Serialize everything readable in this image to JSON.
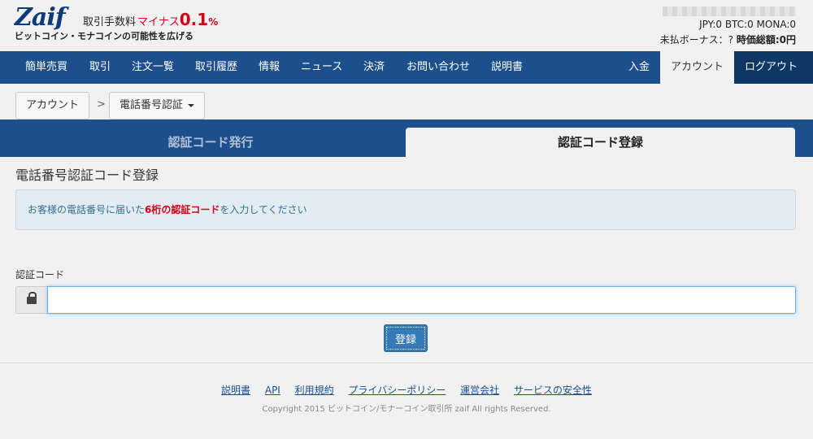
{
  "header": {
    "logo": "Zaif",
    "fee_label": "取引手数料",
    "fee_minus": "マイナス",
    "fee_value": "0.1",
    "fee_unit": "%",
    "tagline": "ビットコイン・モナコインの可能性を広げる",
    "balances": "JPY:0 BTC:0 MONA:0",
    "bonus_label": "未払ボーナス：?",
    "total_label": "時価総額:0円"
  },
  "nav": {
    "items": [
      "簡単売買",
      "取引",
      "注文一覧",
      "取引履歴",
      "情報",
      "ニュース",
      "決済",
      "お問い合わせ",
      "説明書"
    ],
    "deposit": "入金",
    "account": "アカウント",
    "logout": "ログアウト"
  },
  "breadcrumb": {
    "root": "アカウント",
    "separator": ">",
    "current": "電話番号認証"
  },
  "tabs": {
    "issue": "認証コード発行",
    "register": "認証コード登録"
  },
  "main": {
    "title": "電話番号認証コード登録",
    "alert_prefix": "お客様の電話番号に届いた",
    "alert_emphasis": "6桁の認証コード",
    "alert_suffix": "を入力してください",
    "field_label": "認証コード",
    "input_value": "",
    "submit_label": "登録"
  },
  "footer": {
    "links": [
      "説明書",
      "API",
      "利用規約",
      "プライバシーポリシー",
      "運営会社",
      "サービスの安全性"
    ],
    "copyright": "Copyright 2015 ビットコイン/モナーコイン取引所 zaif All rights Reserved."
  },
  "colors": {
    "nav_bg": "#1d4f8c",
    "accent_red": "#d0021b",
    "button_blue": "#337ab7"
  }
}
